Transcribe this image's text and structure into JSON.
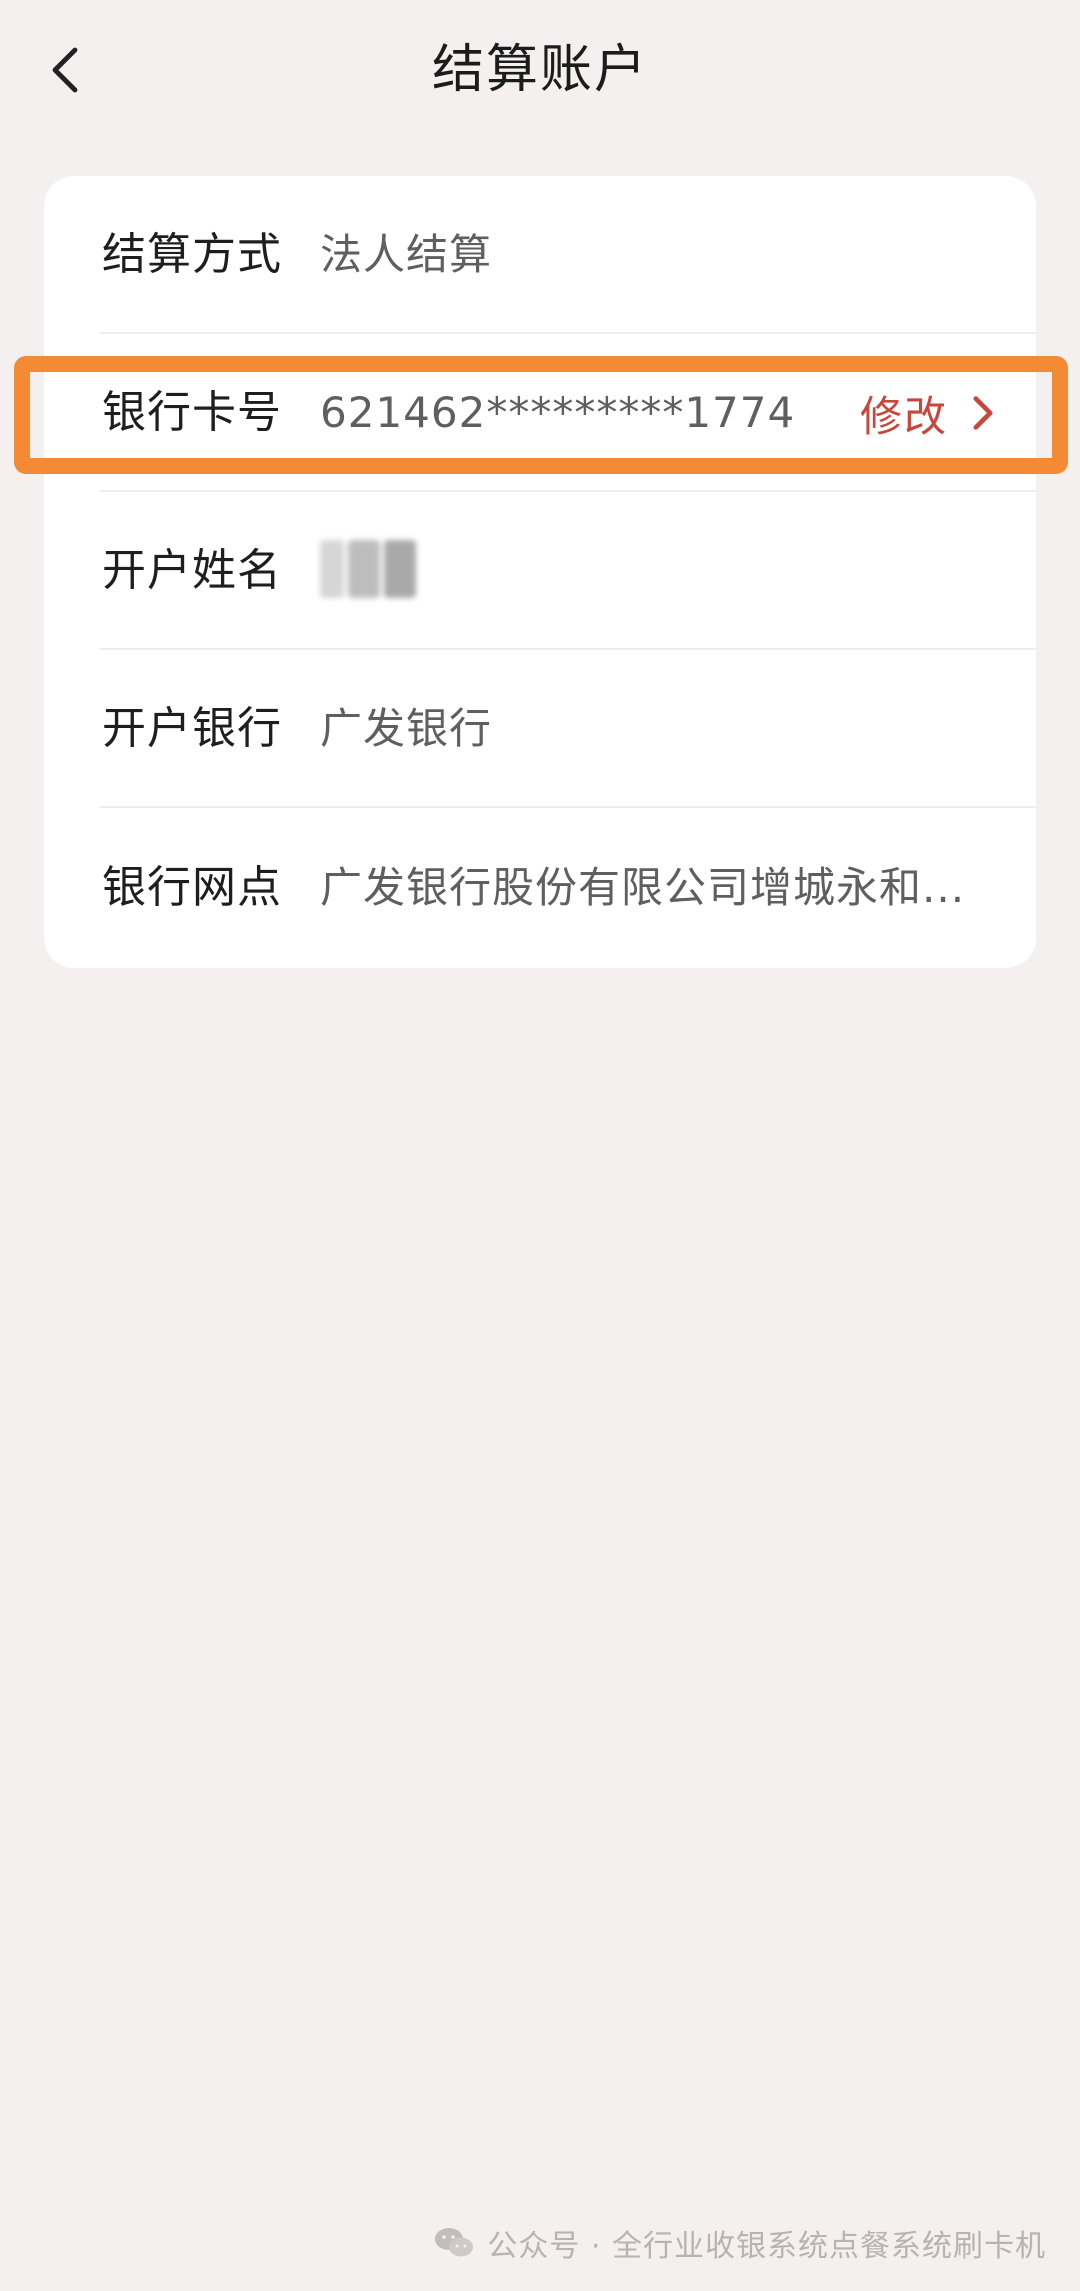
{
  "header": {
    "title": "结算账户",
    "back_icon": "chevron-left-icon"
  },
  "rows": [
    {
      "label": "结算方式",
      "value": "法人结算"
    },
    {
      "label": "银行卡号",
      "value": "621462*********1774",
      "action": "修改"
    },
    {
      "label": "开户姓名",
      "value": ""
    },
    {
      "label": "开户银行",
      "value": "广发银行"
    },
    {
      "label": "银行网点",
      "value": "广发银行股份有限公司增城永和..."
    }
  ],
  "colors": {
    "background": "#f3f0ef",
    "card": "#ffffff",
    "accent_red": "#c8463c",
    "highlight_orange": "#f58a35"
  },
  "watermark": {
    "text": "公众号 · 全行业收银系统点餐系统刷卡机",
    "icon": "wechat-icon"
  }
}
